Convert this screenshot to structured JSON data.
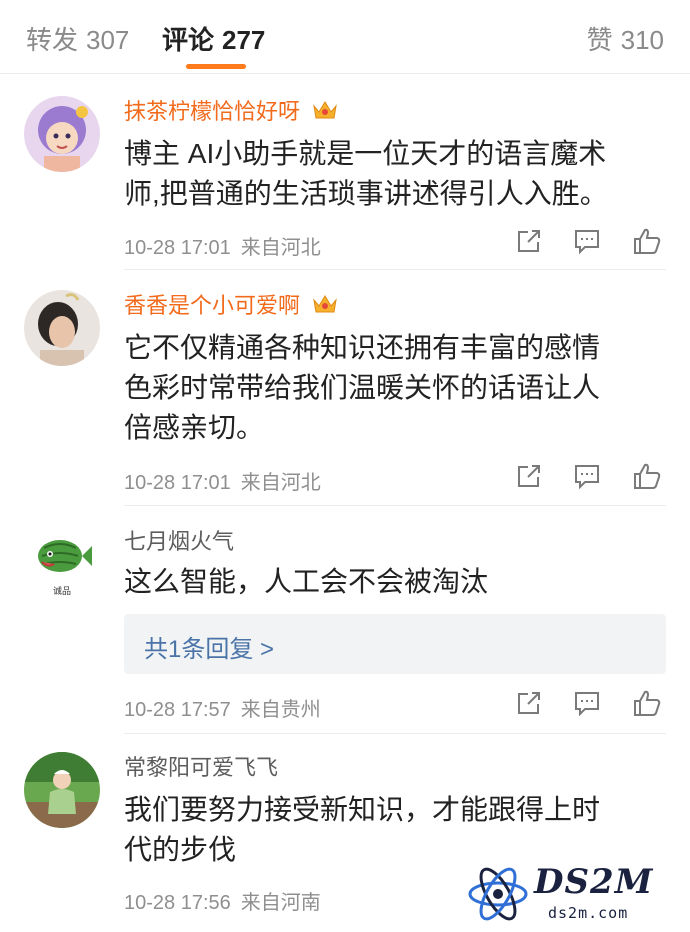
{
  "tabs": {
    "repost": {
      "label": "转发",
      "count": "307"
    },
    "comment": {
      "label": "评论",
      "count": "277"
    },
    "like": {
      "label": "赞",
      "count": "310"
    }
  },
  "accent_color": "#ff7a1a",
  "name_color": "#f26b1d",
  "comments": [
    {
      "user": "抹茶柠檬恰恰好呀",
      "vip_badge": "crown-icon",
      "lines": [
        "博主 AI小助手就是一位天才的语言魔术",
        "师,把普通的生活琐事讲述得引人入胜。"
      ],
      "time": "10-28 17:01",
      "location": "来自河北"
    },
    {
      "user": "香香是个小可爱啊",
      "vip_badge": "crown-icon",
      "lines": [
        "它不仅精通各种知识还拥有丰富的感情",
        "色彩时常带给我们温暖关怀的话语让人",
        "倍感亲切。"
      ],
      "time": "10-28 17:01",
      "location": "来自河北"
    },
    {
      "user": "七月烟火气",
      "lines": [
        "这么智能，人工会不会被淘汰"
      ],
      "reply_summary": "共1条回复 >",
      "avatar_caption": "诚品",
      "time": "10-28 17:57",
      "location": "来自贵州"
    },
    {
      "user": "常黎阳可爱飞飞",
      "lines": [
        "我们要努力接受新知识，才能跟得上时",
        "代的步伐"
      ],
      "time": "10-28 17:56",
      "location": "来自河南"
    }
  ],
  "watermark": {
    "brand": "DS2M",
    "domain": "ds2m.com"
  }
}
